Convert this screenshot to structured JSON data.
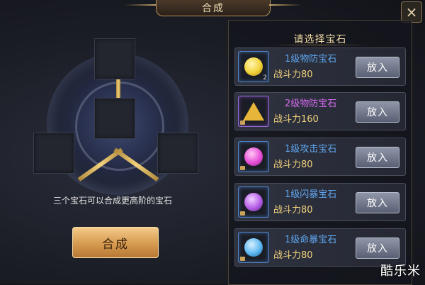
{
  "window": {
    "title": "合成",
    "close_label": "×"
  },
  "left": {
    "hint": "三个宝石可以合成更高阶的宝石",
    "combine_label": "合成"
  },
  "right": {
    "heading": "请选择宝石",
    "gems": [
      {
        "name": "1级物防宝石",
        "power": "战斗力80",
        "count": "2",
        "button": "放入",
        "name_color": "#5fa6f0",
        "gem_color": "#f2d23a",
        "frame": "blue",
        "shape": "round"
      },
      {
        "name": "2级物防宝石",
        "power": "战斗力160",
        "count": "",
        "button": "放入",
        "name_color": "#d56bf0",
        "gem_color": "#e7b53a",
        "frame": "purple",
        "shape": "tri"
      },
      {
        "name": "1级攻击宝石",
        "power": "战斗力80",
        "count": "",
        "button": "放入",
        "name_color": "#5fa6f0",
        "gem_color": "#e64fd6",
        "frame": "blue",
        "shape": "round"
      },
      {
        "name": "1级闪暴宝石",
        "power": "战斗力80",
        "count": "",
        "button": "放入",
        "name_color": "#5fa6f0",
        "gem_color": "#b65ee6",
        "frame": "blue",
        "shape": "round"
      },
      {
        "name": "1级命暴宝石",
        "power": "战斗力80",
        "count": "",
        "button": "放入",
        "name_color": "#5fa6f0",
        "gem_color": "#5cb6f0",
        "frame": "blue",
        "shape": "round"
      }
    ]
  },
  "watermark": "酷乐米"
}
